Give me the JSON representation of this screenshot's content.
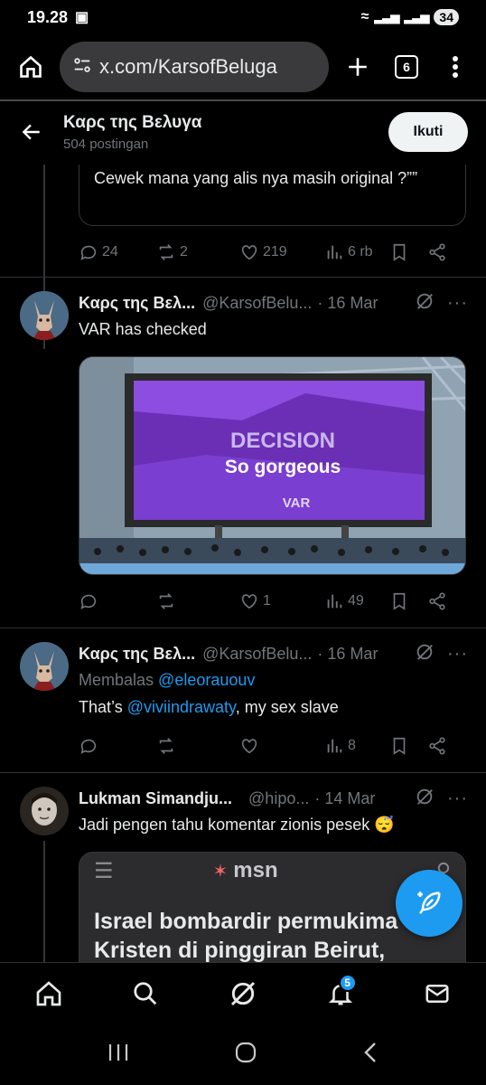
{
  "status_bar": {
    "time": "19.28",
    "battery": "34"
  },
  "browser": {
    "url": "x.com/KarsofBeluga",
    "tab_count": "6"
  },
  "profile": {
    "name": "Καρς της Βελυγα",
    "post_count": "504 postingan",
    "follow_label": "Ikuti"
  },
  "quoted_tail": {
    "text": "Cewek mana yang alis nya masih original ?””"
  },
  "top_actions": {
    "replies": "24",
    "reposts": "2",
    "likes": "219",
    "views": "6 rb"
  },
  "posts": [
    {
      "name": "Καρς της Βελ...",
      "handle": "@KarsofBelu...",
      "date": "· 16 Mar",
      "text": "VAR has checked",
      "media": {
        "title": "DECISION",
        "subtitle": "So gorgeous",
        "brand": "VAR"
      },
      "actions": {
        "replies": "",
        "reposts": "",
        "likes": "1",
        "views": "49"
      }
    },
    {
      "name": "Καρς της Βελ...",
      "handle": "@KarsofBelu...",
      "date": "· 16 Mar",
      "reply_prefix": "Membalas",
      "reply_to": "@eleorauouv",
      "text_start": "That’s",
      "mention": "@viviindrawaty",
      "text_end": ", my sex slave",
      "actions": {
        "replies": "",
        "reposts": "",
        "likes": "",
        "views": "8"
      }
    },
    {
      "name": "Lukman Simandju...",
      "handle": "@hipo...",
      "date": "· 14 Mar",
      "text": "Jadi pengen tahu komentar zionis pesek",
      "emoji": "😴",
      "media": {
        "brand": "msn",
        "headline_1": "Israel bombardir permukima",
        "headline_2": "Kristen di pinggiran Beirut,"
      }
    }
  ],
  "bottom_nav": {
    "notifications_badge": "5"
  },
  "colors": {
    "accent": "#1d9bf0",
    "muted": "#71767b",
    "text": "#e7e9ea",
    "decision_purple": "#7b2fd6"
  }
}
